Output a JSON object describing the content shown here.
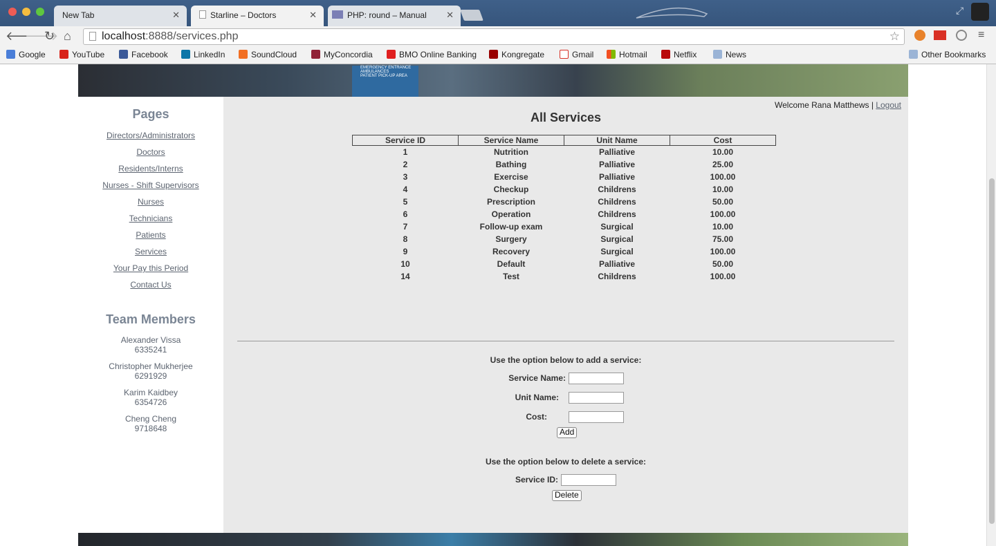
{
  "browser": {
    "tabs": [
      {
        "label": "New Tab"
      },
      {
        "label": "Starline – Doctors"
      },
      {
        "label": "PHP: round – Manual"
      }
    ],
    "url_host": "localhost",
    "url_rest": ":8888/services.php",
    "bookmarks": [
      "Google",
      "YouTube",
      "Facebook",
      "LinkedIn",
      "SoundCloud",
      "MyConcordia",
      "BMO Online Banking",
      "Kongregate",
      "Gmail",
      "Hotmail",
      "Netflix",
      "News"
    ],
    "other_bookmarks": "Other Bookmarks"
  },
  "banner": {
    "sign_lines": [
      "EMERGENCY ENTRANCE",
      "AMBULANCES",
      "PATIENT PICK-UP AREA"
    ]
  },
  "sidebar": {
    "pages_heading": "Pages",
    "links": [
      "Directors/Administrators",
      "Doctors",
      "Residents/Interns",
      "Nurses - Shift Supervisors",
      "Nurses",
      "Technicians",
      "Patients",
      "Services",
      "Your Pay this Period",
      "Contact Us"
    ],
    "team_heading": "Team Members",
    "members": [
      {
        "name": "Alexander Vissa",
        "id": "6335241"
      },
      {
        "name": "Christopher Mukherjee",
        "id": "6291929"
      },
      {
        "name": "Karim Kaidbey",
        "id": "6354726"
      },
      {
        "name": "Cheng Cheng",
        "id": "9718648"
      }
    ]
  },
  "main": {
    "welcome": "Welcome Rana Matthews | ",
    "logout": "Logout",
    "title": "All Services",
    "columns": [
      "Service ID",
      "Service Name",
      "Unit Name",
      "Cost"
    ],
    "rows": [
      [
        "1",
        "Nutrition",
        "Palliative",
        "10.00"
      ],
      [
        "2",
        "Bathing",
        "Palliative",
        "25.00"
      ],
      [
        "3",
        "Exercise",
        "Palliative",
        "100.00"
      ],
      [
        "4",
        "Checkup",
        "Childrens",
        "10.00"
      ],
      [
        "5",
        "Prescription",
        "Childrens",
        "50.00"
      ],
      [
        "6",
        "Operation",
        "Childrens",
        "100.00"
      ],
      [
        "7",
        "Follow-up exam",
        "Surgical",
        "10.00"
      ],
      [
        "8",
        "Surgery",
        "Surgical",
        "75.00"
      ],
      [
        "9",
        "Recovery",
        "Surgical",
        "100.00"
      ],
      [
        "10",
        "Default",
        "Palliative",
        "50.00"
      ],
      [
        "14",
        "Test",
        "Childrens",
        "100.00"
      ]
    ],
    "add_heading": "Use the option below to add a service:",
    "add_service_name_label": "Service Name:",
    "add_unit_name_label": "Unit Name:",
    "add_cost_label": "Cost:",
    "add_button": "Add",
    "delete_heading": "Use the option below to delete a service:",
    "delete_id_label": "Service ID:",
    "delete_button": "Delete"
  }
}
